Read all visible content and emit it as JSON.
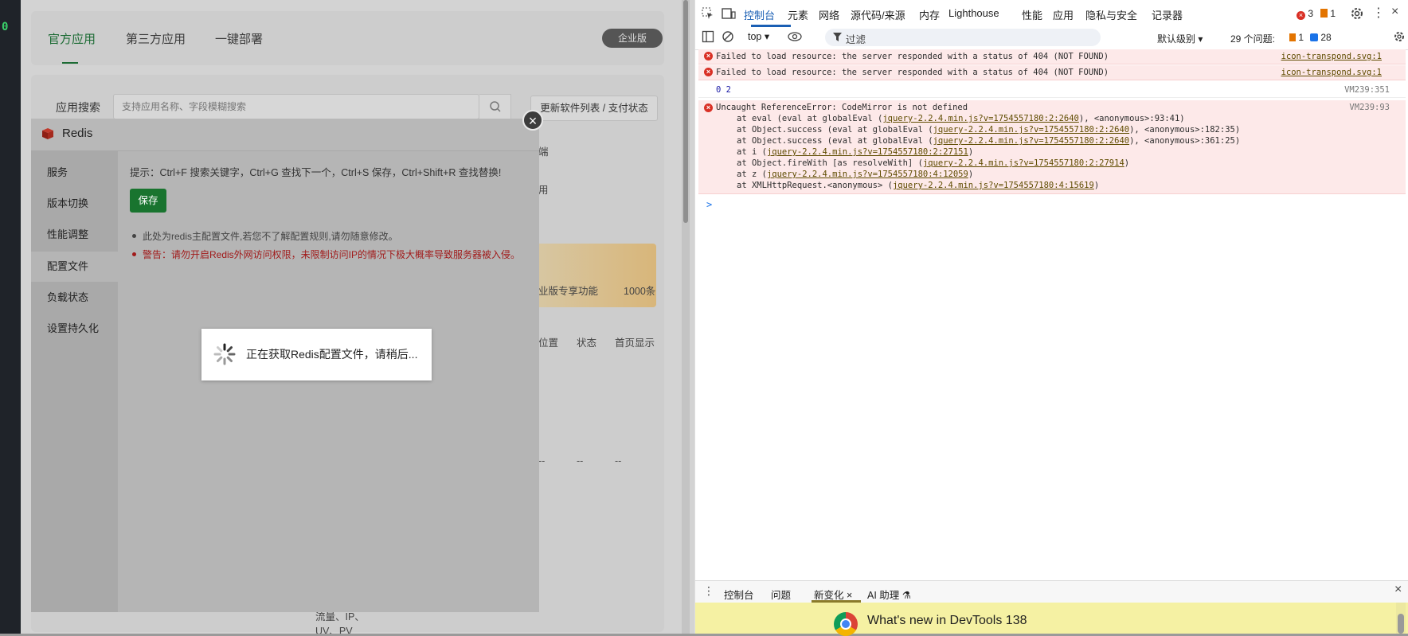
{
  "app": {
    "left_strip_text": "0",
    "tabs": [
      "官方应用",
      "第三方应用",
      "一键部署"
    ],
    "enterprise_badge": "企业版",
    "search_label": "应用搜索",
    "search_placeholder": "支持应用名称、字段模糊搜索",
    "update_button": "更新软件列表 / 支付状态",
    "bg_texts": [
      "端",
      "用",
      "业版专享功能",
      "1000条",
      "位置",
      "状态",
      "首页显示",
      "--",
      "--",
      "--",
      "流量、IP、",
      "UV、PV"
    ]
  },
  "modal": {
    "title": "Redis",
    "side_items": [
      "服务",
      "版本切换",
      "性能调整",
      "配置文件",
      "负载状态",
      "设置持久化"
    ],
    "active_index": 3,
    "hint": "提示：Ctrl+F 搜索关键字，Ctrl+G 查找下一个，Ctrl+S 保存，Ctrl+Shift+R 查找替换!",
    "save_button": "保存",
    "note1": "此处为redis主配置文件,若您不了解配置规则,请勿随意修改。",
    "note2": "警告：请勿开启Redis外网访问权限，未限制访问IP的情况下极大概率导致服务器被入侵。",
    "loading_text": "正在获取Redis配置文件，请稍后..."
  },
  "devtools": {
    "tabs": [
      "控制台",
      "元素",
      "网络",
      "源代码/来源",
      "内存",
      "Lighthouse",
      "性能",
      "应用",
      "隐私与安全",
      "记录器"
    ],
    "error_count": "3",
    "warning_count": "1",
    "context": "top",
    "filter_placeholder": "过滤",
    "level": "默认级别",
    "issues_label": "29 个问题:",
    "issues_warn": "1",
    "issues_info": "28",
    "messages": [
      {
        "type": "error",
        "text": "Failed to load resource: the server responded with a status of 404 (NOT FOUND)",
        "source": "icon-transpond.svg:1"
      },
      {
        "type": "error",
        "text": "Failed to load resource: the server responded with a status of 404 (NOT FOUND)",
        "source": "icon-transpond.svg:1"
      },
      {
        "type": "log",
        "text": "0 2",
        "source": "VM239:351"
      },
      {
        "type": "error",
        "text": "Uncaught ReferenceError: CodeMirror is not defined",
        "source": "VM239:93"
      }
    ],
    "stack": [
      {
        "pre": "at eval (eval at globalEval (",
        "link": "jquery-2.2.4.min.js?v=1754557180:2:2640",
        "post": "), <anonymous>:93:41)"
      },
      {
        "pre": "at Object.success (eval at globalEval (",
        "link": "jquery-2.2.4.min.js?v=1754557180:2:2640",
        "post": "), <anonymous>:182:35)"
      },
      {
        "pre": "at Object.success (eval at globalEval (",
        "link": "jquery-2.2.4.min.js?v=1754557180:2:2640",
        "post": "), <anonymous>:361:25)"
      },
      {
        "pre": "at i (",
        "link": "jquery-2.2.4.min.js?v=1754557180:2:27151",
        "post": ")"
      },
      {
        "pre": "at Object.fireWith [as resolveWith] (",
        "link": "jquery-2.2.4.min.js?v=1754557180:2:27914",
        "post": ")"
      },
      {
        "pre": "at z (",
        "link": "jquery-2.2.4.min.js?v=1754557180:4:12059",
        "post": ")"
      },
      {
        "pre": "at XMLHttpRequest.<anonymous> (",
        "link": "jquery-2.2.4.min.js?v=1754557180:4:15619",
        "post": ")"
      }
    ],
    "prompt": ">",
    "bottom_tabs": [
      "控制台",
      "问题",
      "新变化",
      "AI 助理"
    ],
    "whats_new": "What's new in DevTools 138"
  }
}
